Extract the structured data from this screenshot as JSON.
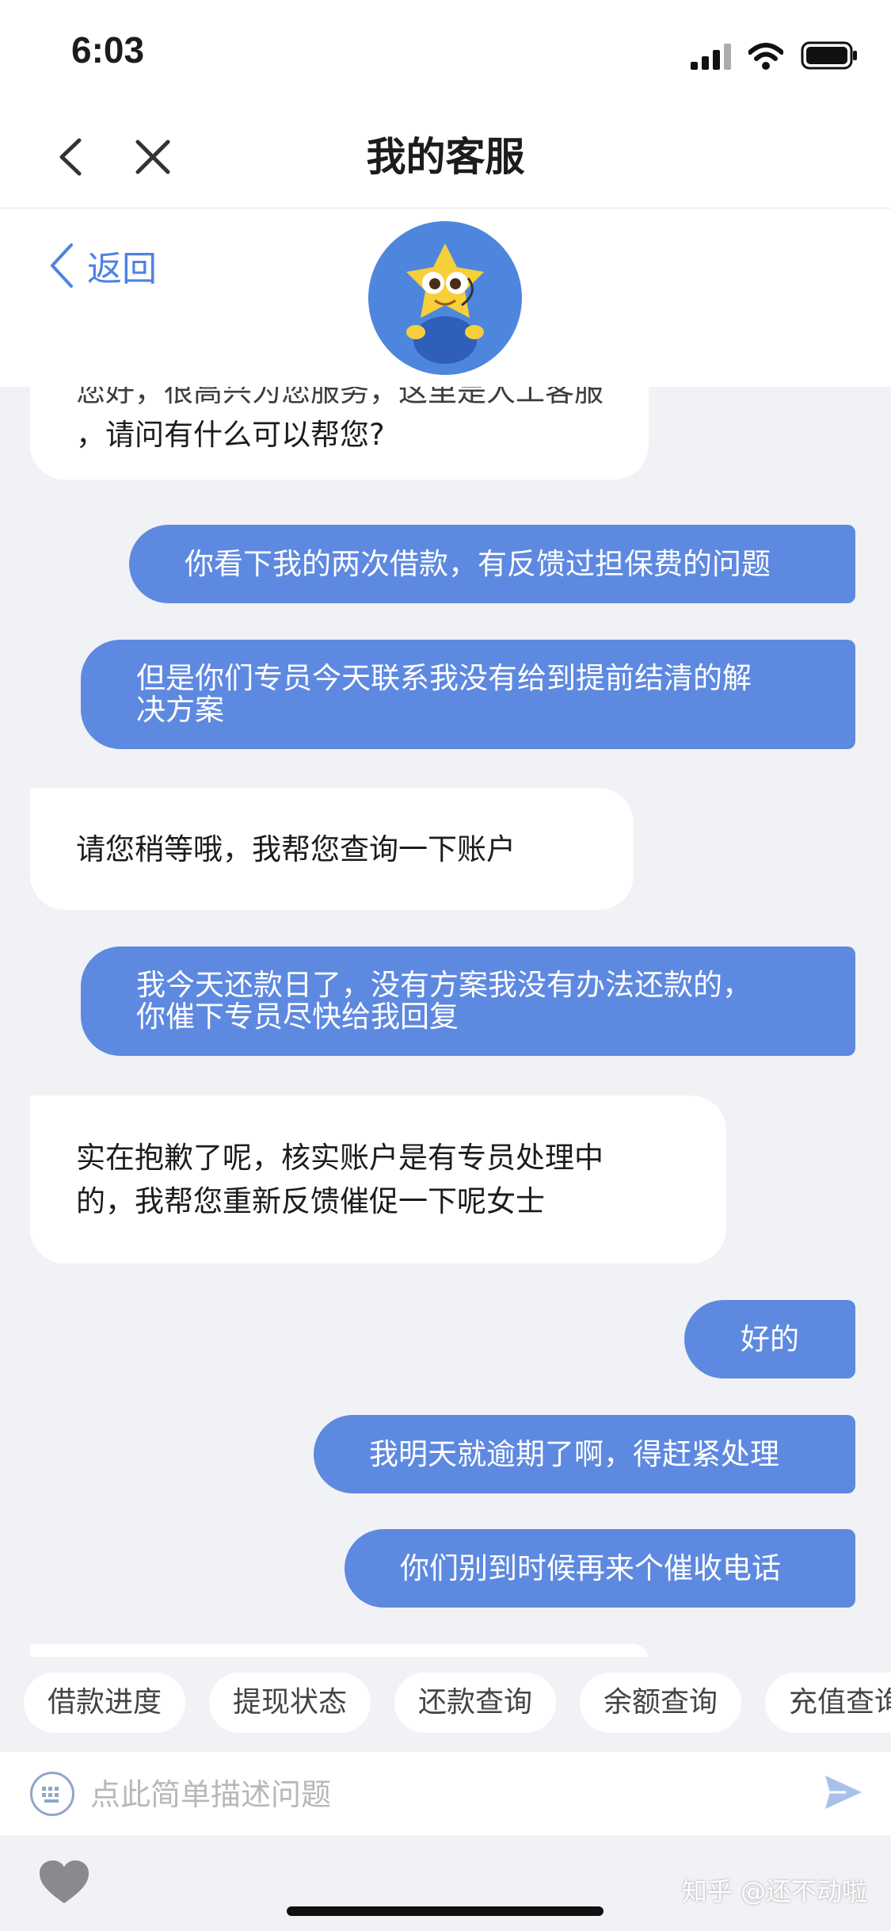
{
  "status_bar": {
    "time": "6:03"
  },
  "nav": {
    "title": "我的客服"
  },
  "sub_header": {
    "return_label": "返回"
  },
  "messages": [
    {
      "role": "bot",
      "line1": "您好，很高兴为您服务，这里是人工客服",
      "line2": "，请问有什么可以帮您?"
    },
    {
      "role": "user",
      "text": "你看下我的两次借款，有反馈过担保费的问题"
    },
    {
      "role": "user",
      "line1": "但是你们专员今天联系我没有给到提前结清的解",
      "line2": "决方案"
    },
    {
      "role": "bot",
      "text": "请您稍等哦，我帮您查询一下账户"
    },
    {
      "role": "user",
      "line1": "我今天还款日了，没有方案我没有办法还款的，",
      "line2": "你催下专员尽快给我回复"
    },
    {
      "role": "bot",
      "line1": "实在抱歉了呢，核实账户是有专员处理中",
      "line2": "的，我帮您重新反馈催促一下呢女士"
    },
    {
      "role": "user",
      "text": "好的"
    },
    {
      "role": "user",
      "text": "我明天就逾期了啊，得赶紧处理"
    },
    {
      "role": "user",
      "text": "你们别到时候再来个催收电话"
    }
  ],
  "quick_replies": [
    "借款进度",
    "提现状态",
    "还款查询",
    "余额查询",
    "充值查询"
  ],
  "input": {
    "placeholder": "点此简单描述问题",
    "value": ""
  },
  "watermark": "知乎 @还不动啦",
  "colors": {
    "accent": "#5e89e0",
    "link": "#4f82e3",
    "background": "#f0f2f5",
    "bubble_bot": "#ffffff"
  }
}
